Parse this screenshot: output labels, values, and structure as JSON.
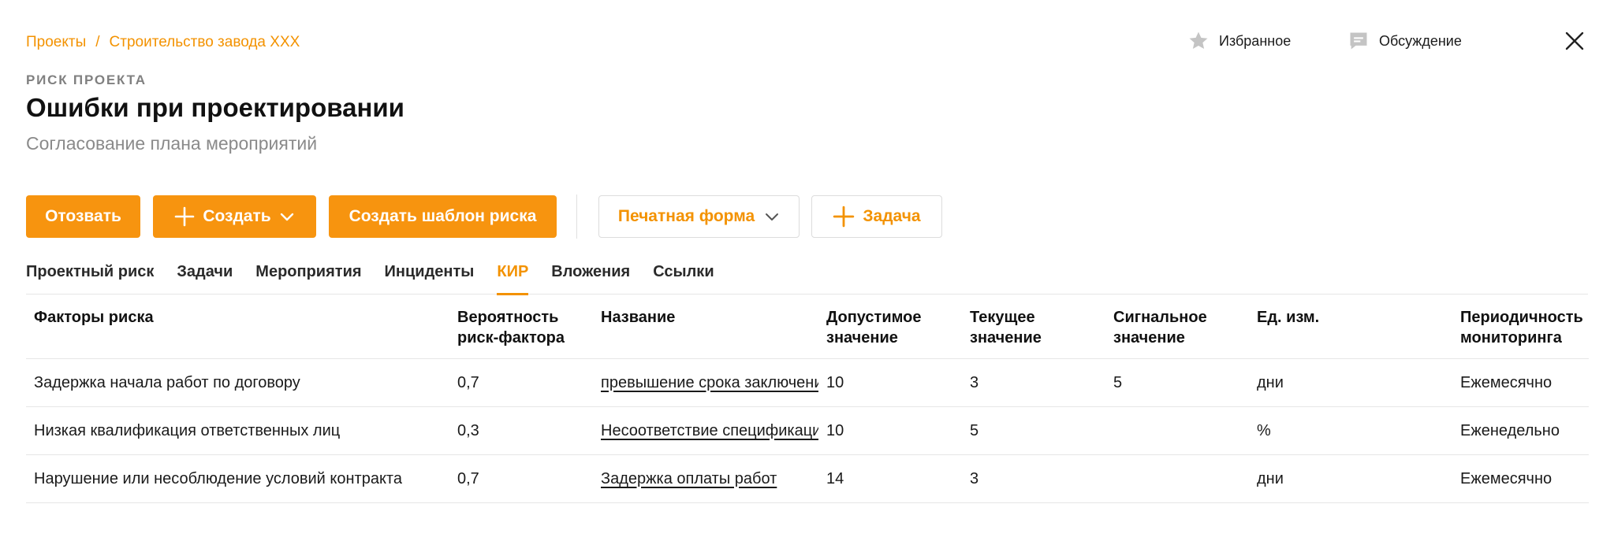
{
  "breadcrumb": {
    "items": [
      "Проекты",
      "Строительство завода ХХХ"
    ],
    "separator": "/"
  },
  "header_actions": {
    "favorite": "Избранное",
    "discussion": "Обсуждение"
  },
  "kicker": "РИСК ПРОЕКТА",
  "title": "Ошибки при проектировании",
  "subtitle": "Согласование плана мероприятий",
  "toolbar": {
    "recall": "Отозвать",
    "create": "Создать",
    "create_template": "Создать шаблон риска",
    "print_form": "Печатная форма",
    "task": "Задача"
  },
  "tabs": [
    {
      "label": "Проектный риск",
      "active": false
    },
    {
      "label": "Задачи",
      "active": false
    },
    {
      "label": "Мероприятия",
      "active": false
    },
    {
      "label": "Инциденты",
      "active": false
    },
    {
      "label": "КИР",
      "active": true
    },
    {
      "label": "Вложения",
      "active": false
    },
    {
      "label": "Ссылки",
      "active": false
    }
  ],
  "table": {
    "headers": [
      "Факторы риска",
      "Вероятность риск-фактора",
      "Название",
      "Допустимое значение",
      "Текущее значение",
      "Сигнальное значение",
      "Ед. изм.",
      "Периодичность мониторинга"
    ],
    "rows": [
      {
        "factor": "Задержка начала работ по договору",
        "probability": "0,7",
        "name": "превышение срока заключения",
        "allowed": "10",
        "current": "3",
        "signal": "5",
        "unit": "дни",
        "period": "Ежемесячно"
      },
      {
        "factor": "Низкая квалификация ответственных лиц",
        "probability": "0,3",
        "name": "Несоответствие спецификации",
        "allowed": "10",
        "current": "5",
        "signal": "",
        "unit": "%",
        "period": "Еженедельно"
      },
      {
        "factor": "Нарушение или несоблюдение условий контракта",
        "probability": "0,7",
        "name": "Задержка оплаты работ",
        "allowed": "14",
        "current": "3",
        "signal": "",
        "unit": "дни",
        "period": "Ежемесячно"
      }
    ]
  },
  "colors": {
    "accent": "#f7940f",
    "muted": "#8a8a8a",
    "icon": "#c4c4c4"
  },
  "icons": [
    "star-icon",
    "chat-icon",
    "close-icon",
    "plus-icon",
    "chevron-down-icon"
  ]
}
